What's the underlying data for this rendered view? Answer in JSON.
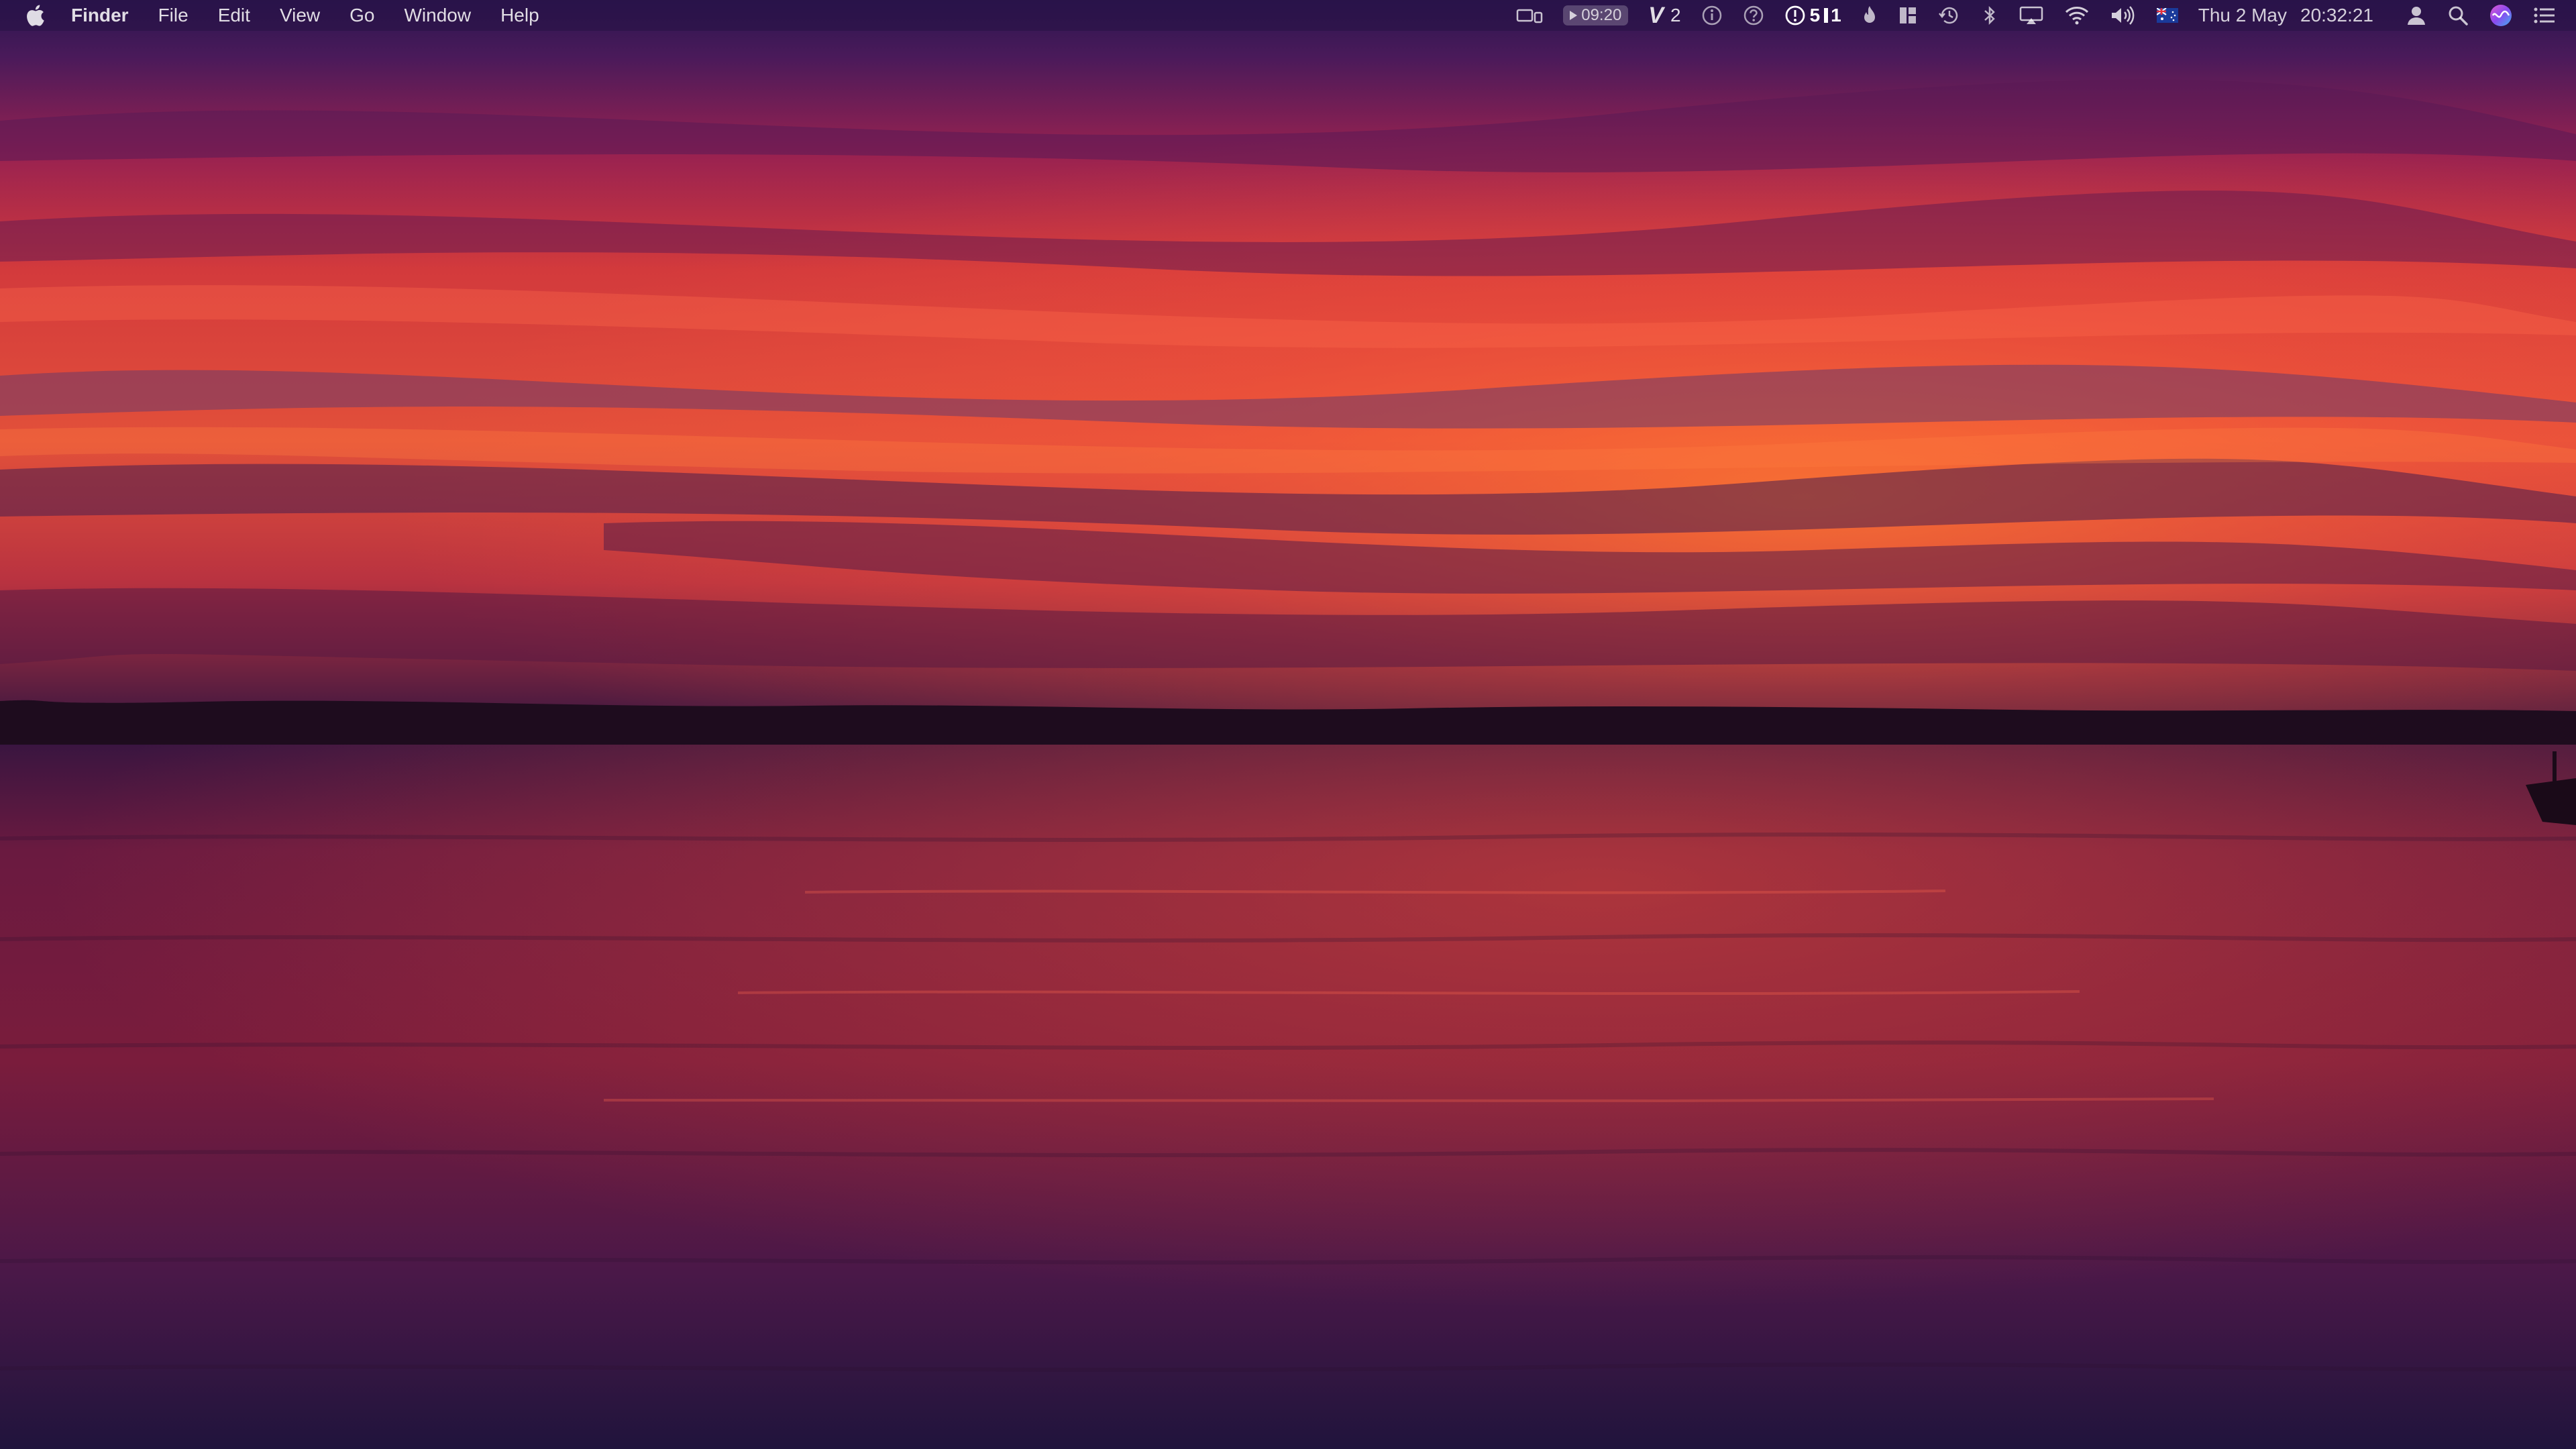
{
  "menubar": {
    "app_name": "Finder",
    "menus": [
      "File",
      "Edit",
      "View",
      "Go",
      "Window",
      "Help"
    ],
    "status_items": {
      "timer": "09:20",
      "vpn_count": "2",
      "meter_value": "5",
      "meter_suffix": "1",
      "date": "Thu 2 May",
      "time": "20:32:21"
    }
  },
  "icons": {
    "apple": "apple-icon",
    "display": "display-mirroring-icon",
    "info": "info-icon",
    "help": "help-icon",
    "alert": "alert-icon",
    "flame": "flame-icon",
    "layout": "layout-icon",
    "time_machine": "time-machine-icon",
    "bluetooth": "bluetooth-icon",
    "airplay": "airplay-icon",
    "wifi": "wifi-icon",
    "volume": "volume-icon",
    "flag": "australian-flag-icon",
    "user": "user-icon",
    "search": "spotlight-search-icon",
    "siri": "siri-icon",
    "notifications": "notification-center-icon"
  },
  "colors": {
    "menubar_bg": "#28124a",
    "sky_top": "#3a1a55",
    "sky_mid": "#c0304a",
    "sky_glow": "#f05a30",
    "water": "#5a1a40"
  }
}
